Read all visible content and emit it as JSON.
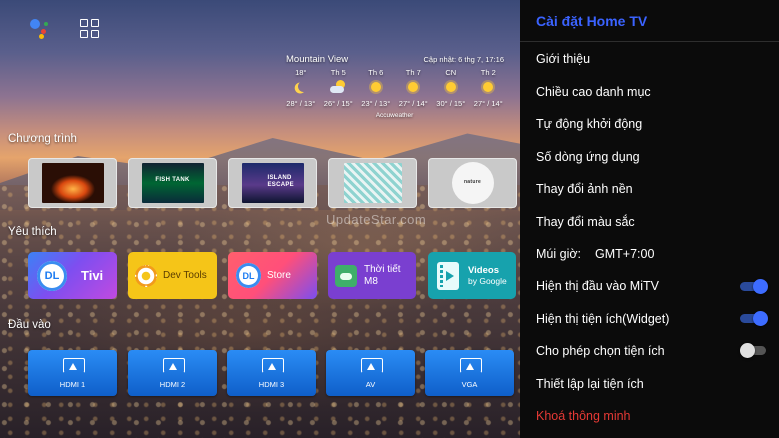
{
  "top_icons": {
    "assistant": "google-assistant-icon",
    "apps": "apps-grid-icon"
  },
  "weather": {
    "city": "Mountain View",
    "updated": "Cập nhật: 6 thg 7, 17:16",
    "provider": "Accuweather",
    "days": [
      {
        "name": "18°",
        "icon": "moon",
        "temps": "28° / 13°"
      },
      {
        "name": "Th 5",
        "icon": "cloudsun",
        "temps": "26° / 15°"
      },
      {
        "name": "Th 6",
        "icon": "sun",
        "temps": "23° / 13°"
      },
      {
        "name": "Th 7",
        "icon": "sun",
        "temps": "27° / 14°"
      },
      {
        "name": "CN",
        "icon": "sun",
        "temps": "30° / 15°"
      },
      {
        "name": "Th 2",
        "icon": "sun",
        "temps": "27° / 14°"
      }
    ]
  },
  "sections": {
    "programs": "Chương trình",
    "favorites": "Yêu thích",
    "inputs": "Đầu vào"
  },
  "programs": [
    {
      "caption": "",
      "theme": "fire"
    },
    {
      "caption": "FISH TANK",
      "theme": "fish"
    },
    {
      "caption": "ISLAND ESCAPE",
      "theme": "island"
    },
    {
      "caption": "",
      "theme": "tiles"
    },
    {
      "caption": "nature",
      "theme": "nature"
    }
  ],
  "favorites": {
    "tivi": {
      "badge": "DL",
      "label": "Tivi"
    },
    "devtools": {
      "label": "Dev Tools"
    },
    "store": {
      "badge": "DL",
      "label": "Store"
    },
    "weather": {
      "line1": "Thời tiết",
      "line2": "M8"
    },
    "videos": {
      "line1": "Videos",
      "line2": "by Google"
    }
  },
  "inputs": [
    "HDMI 1",
    "HDMI 2",
    "HDMI 3",
    "AV",
    "VGA"
  ],
  "watermark": "UpdateStar.com",
  "panel": {
    "title": "Cài đặt Home TV",
    "items": [
      "Giới thiệu",
      "Chiều cao danh mục",
      "Tự động khởi động",
      "Số dòng ứng dụng",
      "Thay đổi ảnh nền",
      "Thay đổi màu sắc",
      "Múi giờ:",
      "Hiện thị đầu vào MiTV",
      "Hiện thị tiện ích(Widget)",
      "Cho phép chọn tiện ích",
      "Thiết lập lại tiện ích",
      "Khoá thông minh"
    ],
    "timezone_value": "GMT+7:00",
    "toggles": {
      "show_mitv_input": true,
      "show_widget": true,
      "allow_widget_select": false
    },
    "colors": {
      "title": "#3b63ff",
      "danger": "#e53935",
      "toggle_on": "#3d6cff"
    }
  }
}
